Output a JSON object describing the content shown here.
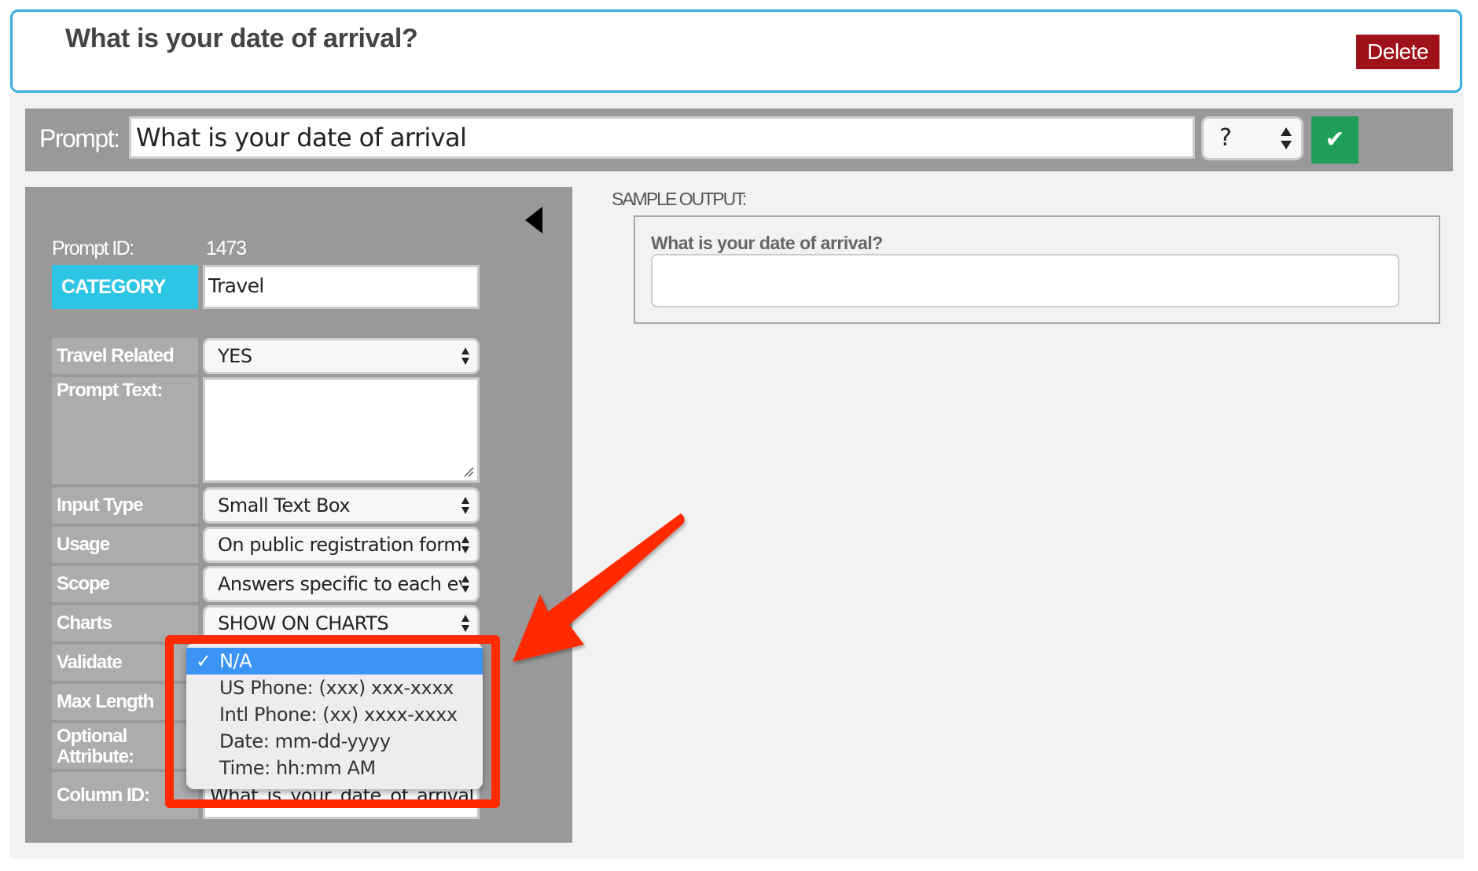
{
  "header": {
    "title": "What is your date of arrival?",
    "delete_label": "Delete"
  },
  "prompt_bar": {
    "label": "Prompt:",
    "value": "What is your date of arrival",
    "suffix_select": "?",
    "confirm_icon": "✔"
  },
  "panel": {
    "collapse_icon": "triangle-left",
    "prompt_id_label": "Prompt ID:",
    "prompt_id_value": "1473",
    "category_label": "CATEGORY",
    "category_value": "Travel",
    "rows": {
      "travel_related": {
        "label": "Travel Related",
        "value": "YES"
      },
      "prompt_text": {
        "label": "Prompt Text:",
        "value": ""
      },
      "input_type": {
        "label": "Input Type",
        "value": "Small Text Box"
      },
      "usage": {
        "label": "Usage",
        "value": "On public registration form"
      },
      "scope": {
        "label": "Scope",
        "value": "Answers specific to each event"
      },
      "charts": {
        "label": "Charts",
        "value": "SHOW ON CHARTS"
      },
      "validate": {
        "label": "Validate",
        "value": "N/A"
      },
      "max_length": {
        "label": "Max Length",
        "value": ""
      },
      "optional_attribute": {
        "label": "Optional Attribute:",
        "value": ""
      },
      "column_id": {
        "label": "Column ID:",
        "value": "What_is_your_date_of_arrival"
      }
    }
  },
  "validate_dropdown": {
    "check_mark": "✓",
    "options": [
      {
        "label": "N/A",
        "selected": true
      },
      {
        "label": "US Phone: (xxx) xxx-xxxx",
        "selected": false
      },
      {
        "label": "Intl Phone: (xx) xxxx-xxxx",
        "selected": false
      },
      {
        "label": "Date: mm-dd-yyyy",
        "selected": false
      },
      {
        "label": "Time: hh:mm AM",
        "selected": false
      }
    ]
  },
  "sample_output": {
    "label": "SAMPLE OUTPUT:",
    "question": "What is your date of arrival?",
    "answer": ""
  },
  "colors": {
    "card_border": "#3aaee0",
    "delete": "#a01219",
    "confirm": "#1e9e58",
    "category": "#2ec5e5",
    "dropdown_highlight": "#3a94f6",
    "annotation": "#ff2a00"
  }
}
